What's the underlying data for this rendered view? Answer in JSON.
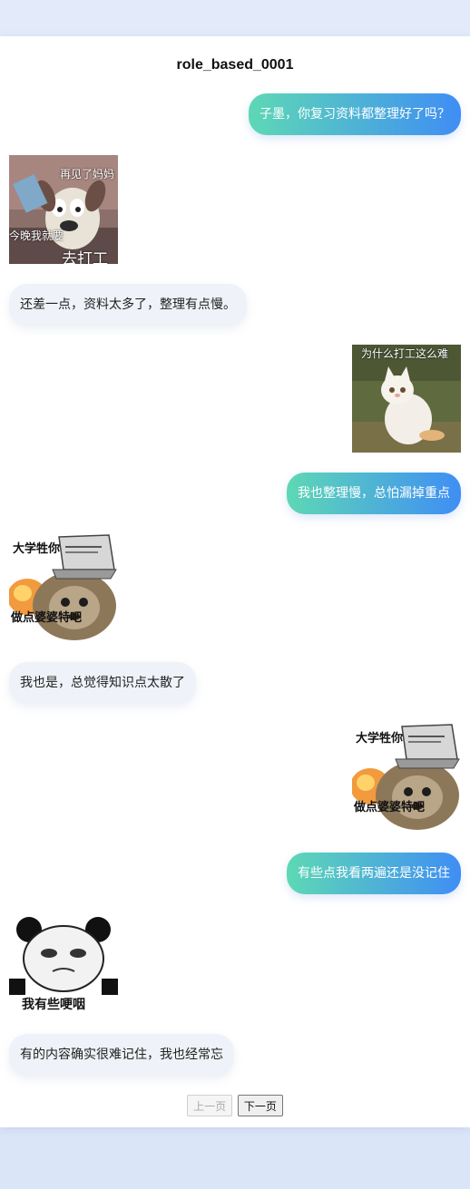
{
  "page": {
    "title": "role_based_0001"
  },
  "messages": [
    {
      "side": "right",
      "type": "text",
      "text": "子墨，你复习资料都整理好了吗？"
    },
    {
      "side": "left",
      "type": "sticker",
      "caption_top": "再见了妈妈",
      "caption_mid": "今晚我就要",
      "caption_bottom": "去打工"
    },
    {
      "side": "left",
      "type": "text",
      "text": "还差一点，资料太多了，整理有点慢。"
    },
    {
      "side": "right",
      "type": "sticker",
      "caption_top": "为什么打工这么难"
    },
    {
      "side": "right",
      "type": "text",
      "text": "我也整理慢，总怕漏掉重点"
    },
    {
      "side": "left",
      "type": "sticker",
      "caption_top": "大学牲你",
      "caption_bottom": "做点婆婆特吧"
    },
    {
      "side": "left",
      "type": "text",
      "text": "我也是，总觉得知识点太散了"
    },
    {
      "side": "right",
      "type": "sticker",
      "caption_top": "大学牲你",
      "caption_bottom": "做点婆婆特吧"
    },
    {
      "side": "right",
      "type": "text",
      "text": "有些点我看两遍还是没记住"
    },
    {
      "side": "left",
      "type": "sticker",
      "caption_bottom": "我有些哽咽"
    },
    {
      "side": "left",
      "type": "text",
      "text": "有的内容确实很难记住，我也经常忘"
    }
  ],
  "pager": {
    "prev_label": "上一页",
    "next_label": "下一页"
  }
}
